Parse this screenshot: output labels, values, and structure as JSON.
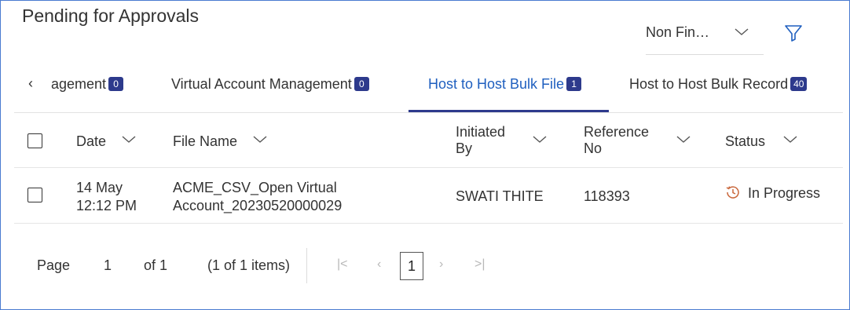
{
  "header": {
    "title": "Pending for Approvals",
    "type_filter": "Non Fin…",
    "filter_icon": "funnel-icon"
  },
  "tabs": [
    {
      "label": "agement",
      "count": "0"
    },
    {
      "label": "Virtual Account Management",
      "count": "0"
    },
    {
      "label": "Host to Host Bulk File",
      "count": "1",
      "active": true
    },
    {
      "label": "Host to Host Bulk Record",
      "count": "40"
    }
  ],
  "table": {
    "columns": {
      "date": "Date",
      "file_name": "File Name",
      "initiated_by_1": "Initiated",
      "initiated_by_2": "By",
      "reference_1": "Reference",
      "reference_2": "No",
      "status": "Status"
    },
    "rows": [
      {
        "date_line1": "14 May",
        "date_line2": "12:12 PM",
        "file_line1": "ACME_CSV_Open Virtual",
        "file_line2": "Account_20230520000029",
        "initiated_by": "SWATI THITE",
        "reference_no": "118393",
        "status": "In Progress"
      }
    ]
  },
  "pagination": {
    "page_label": "Page",
    "page_value": "1",
    "of_label": "of 1",
    "items_summary": "(1 of 1 items)",
    "current_page": "1"
  },
  "colors": {
    "accent": "#2d3a8c",
    "link": "#1f5fbf",
    "status_in_progress": "#c9663a"
  }
}
